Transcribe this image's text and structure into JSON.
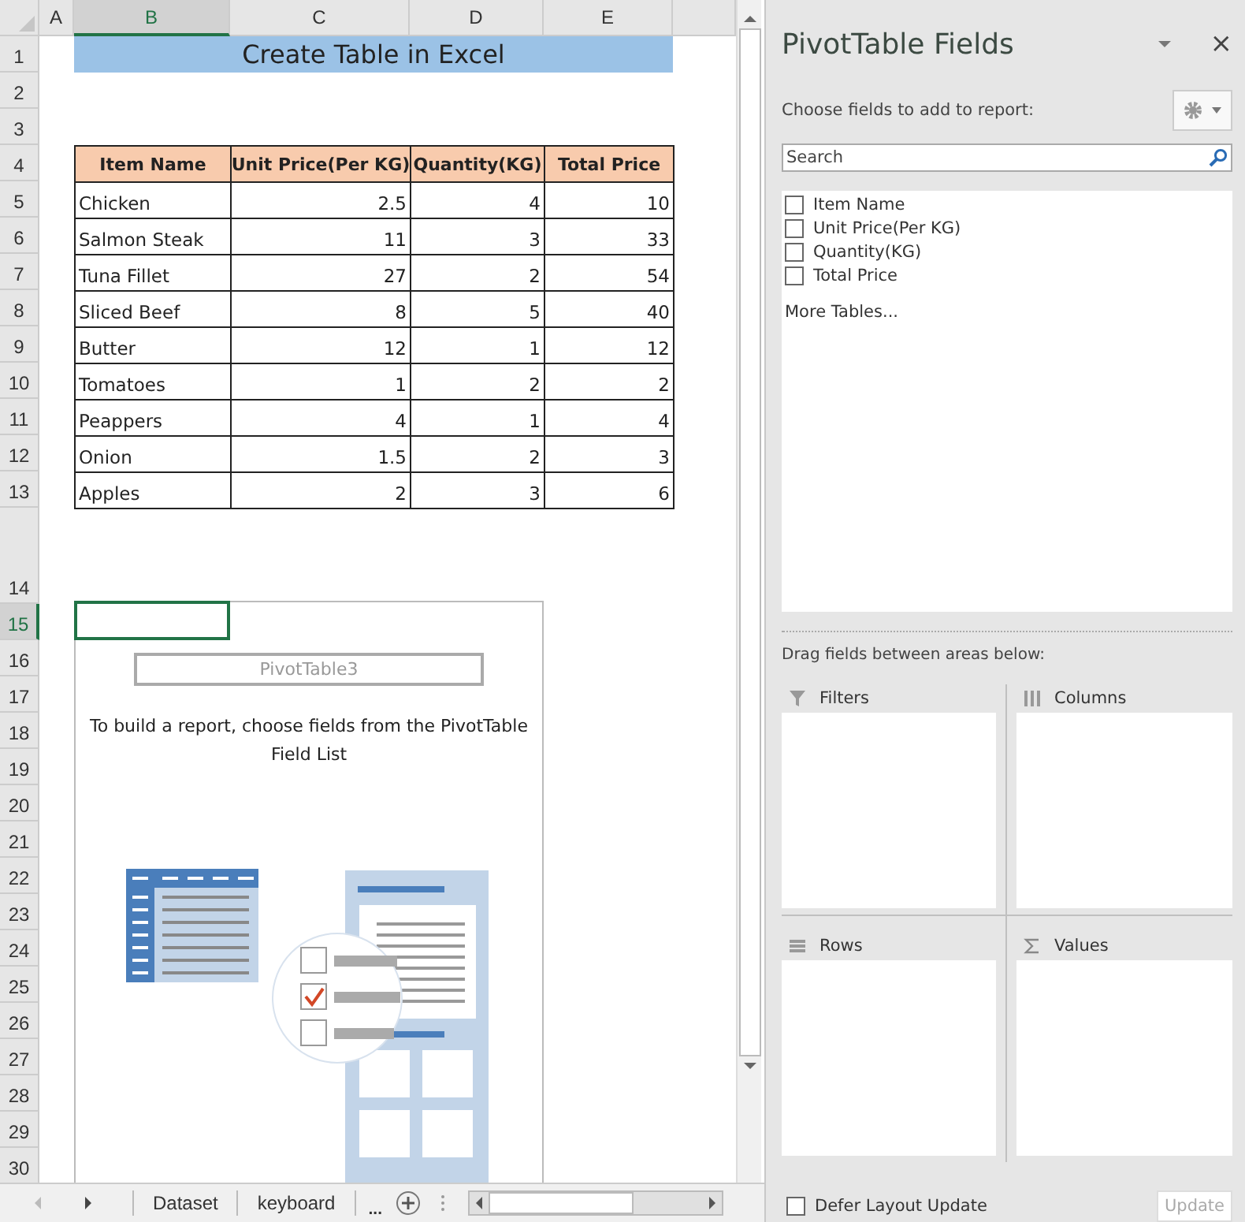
{
  "sheet": {
    "columns": [
      {
        "label": "A",
        "selected": false
      },
      {
        "label": "B",
        "selected": true
      },
      {
        "label": "C",
        "selected": false
      },
      {
        "label": "D",
        "selected": false
      },
      {
        "label": "E",
        "selected": false
      }
    ],
    "rows": [
      {
        "label": "1",
        "selected": false
      },
      {
        "label": "2",
        "selected": false
      },
      {
        "label": "3",
        "selected": false
      },
      {
        "label": "4",
        "selected": false
      },
      {
        "label": "5",
        "selected": false
      },
      {
        "label": "6",
        "selected": false
      },
      {
        "label": "7",
        "selected": false
      },
      {
        "label": "8",
        "selected": false
      },
      {
        "label": "9",
        "selected": false
      },
      {
        "label": "10",
        "selected": false
      },
      {
        "label": "11",
        "selected": false
      },
      {
        "label": "12",
        "selected": false
      },
      {
        "label": "13",
        "selected": false
      },
      {
        "label": "14",
        "selected": false
      },
      {
        "label": "15",
        "selected": true
      },
      {
        "label": "16",
        "selected": false
      },
      {
        "label": "17",
        "selected": false
      },
      {
        "label": "18",
        "selected": false
      },
      {
        "label": "19",
        "selected": false
      },
      {
        "label": "20",
        "selected": false
      },
      {
        "label": "21",
        "selected": false
      },
      {
        "label": "22",
        "selected": false
      },
      {
        "label": "23",
        "selected": false
      },
      {
        "label": "24",
        "selected": false
      },
      {
        "label": "25",
        "selected": false
      },
      {
        "label": "26",
        "selected": false
      },
      {
        "label": "27",
        "selected": false
      },
      {
        "label": "28",
        "selected": false
      },
      {
        "label": "29",
        "selected": false
      },
      {
        "label": "30",
        "selected": false
      }
    ],
    "title": "Create Table in Excel",
    "table": {
      "columns": [
        "Item Name",
        "Unit Price(Per KG)",
        "Quantity(KG)",
        "Total Price"
      ],
      "rows": [
        [
          "Chicken",
          "2.5",
          "4",
          "10"
        ],
        [
          "Salmon Steak",
          "11",
          "3",
          "33"
        ],
        [
          "Tuna Fillet",
          "27",
          "2",
          "54"
        ],
        [
          "Sliced Beef",
          "8",
          "5",
          "40"
        ],
        [
          "Butter",
          "12",
          "1",
          "12"
        ],
        [
          "Tomatoes",
          "1",
          "2",
          "2"
        ],
        [
          "Peappers",
          "4",
          "1",
          "4"
        ],
        [
          "Onion",
          "1.5",
          "2",
          "3"
        ],
        [
          "Apples",
          "2",
          "3",
          "6"
        ]
      ]
    },
    "pivot_placeholder": {
      "name": "PivotTable3",
      "instruction": "To build a report, choose fields from the PivotTable Field List"
    }
  },
  "sheet_tabs": [
    {
      "label": "Dataset"
    },
    {
      "label": "keyboard"
    }
  ],
  "more_sheets": "...",
  "pivot_pane": {
    "title": "PivotTable Fields",
    "close": "×",
    "subtitle": "Choose fields to add to report:",
    "search": {
      "placeholder": "Search"
    },
    "fields": [
      {
        "label": "Item Name",
        "checked": false
      },
      {
        "label": "Unit Price(Per KG)",
        "checked": false
      },
      {
        "label": "Quantity(KG)",
        "checked": false
      },
      {
        "label": "Total Price",
        "checked": false
      }
    ],
    "more_tables": "More Tables...",
    "drag_hint": "Drag fields between areas below:",
    "areas": [
      {
        "label": "Filters",
        "kind": "filters"
      },
      {
        "label": "Columns",
        "kind": "columns"
      },
      {
        "label": "Rows",
        "kind": "rows"
      },
      {
        "label": "Values",
        "kind": "values"
      }
    ],
    "defer": {
      "label": "Defer Layout Update",
      "checked": false
    },
    "update": {
      "label": "Update",
      "disabled": true
    }
  }
}
